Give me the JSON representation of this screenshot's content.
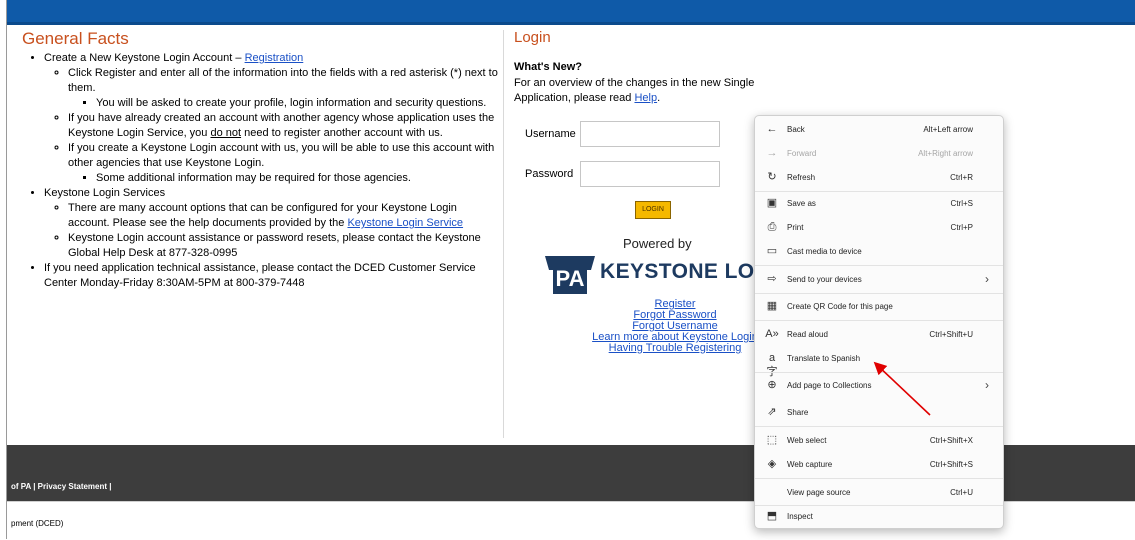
{
  "general_facts": {
    "title": "General Facts",
    "b1_text": "Create a New Keystone Login Account – ",
    "b1_link": "Registration",
    "b1_s1": "Click Register and enter all of the information into the fields with a red asterisk (*) next to them.",
    "b1_s1_s1": "You will be asked to create your profile, login information and security questions.",
    "b1_s2_pre": "If you have already created an account with another agency whose application uses the Keystone Login Service, you ",
    "b1_s2_u": "do not",
    "b1_s2_post": " need to register another account with us.",
    "b1_s3": "If you create a Keystone Login account with us, you will be able to use this account with other agencies that use Keystone Login.",
    "b1_s3_s1": "Some additional information may be required for those agencies.",
    "b2_text": "Keystone Login Services",
    "b2_s1_pre": "There are many account options that can be configured for your Keystone Login account. Please see the help documents provided by the ",
    "b2_s1_link": "Keystone Login Service",
    "b2_s2": "Keystone Login account assistance or password resets, please contact the Keystone Global Help Desk at 877-328-0995",
    "b3_text": "If you need application technical assistance, please contact the DCED Customer Service Center Monday-Friday 8:30AM-5PM at 800-379-7448"
  },
  "login": {
    "title": "Login",
    "whats_new_heading": "What's New?",
    "whats_new_text": "For an overview of the changes in the new Single Application, please read ",
    "whats_new_link": "Help",
    "whats_new_end": ".",
    "username_label": "Username",
    "password_label": "Password",
    "login_button": "LOGIN",
    "powered_by": "Powered by",
    "logo_pa": "PA",
    "logo_text": "KEYSTONE LOGIN",
    "links": [
      "Register",
      "Forgot Password",
      "Forgot Username",
      "Learn more about Keystone Login",
      "Having Trouble Registering"
    ]
  },
  "footer": {
    "dark_text": "of PA  |  Privacy Statement  |",
    "light_text": "pment (DCED)"
  },
  "context_menu": {
    "items": [
      {
        "icon": "back-arrow-icon",
        "label": "Back",
        "shortcut": "Alt+Left arrow",
        "enabled": true
      },
      {
        "icon": "forward-arrow-icon",
        "label": "Forward",
        "shortcut": "Alt+Right arrow",
        "enabled": false
      },
      {
        "icon": "refresh-icon",
        "label": "Refresh",
        "shortcut": "Ctrl+R",
        "enabled": true
      },
      {
        "icon": "save-icon",
        "label": "Save as",
        "shortcut": "Ctrl+S",
        "enabled": true
      },
      {
        "icon": "print-icon",
        "label": "Print",
        "shortcut": "Ctrl+P",
        "enabled": true
      },
      {
        "icon": "cast-icon",
        "label": "Cast media to device",
        "shortcut": "",
        "enabled": true
      },
      {
        "icon": "send-devices-icon",
        "label": "Send to your devices",
        "shortcut": "",
        "enabled": true,
        "submenu": true
      },
      {
        "icon": "qr-code-icon",
        "label": "Create QR Code for this page",
        "shortcut": "",
        "enabled": true
      },
      {
        "icon": "read-aloud-icon",
        "label": "Read aloud",
        "shortcut": "Ctrl+Shift+U",
        "enabled": true
      },
      {
        "icon": "translate-icon",
        "label": "Translate to Spanish",
        "shortcut": "",
        "enabled": true
      },
      {
        "icon": "collections-icon",
        "label": "Add page to Collections",
        "shortcut": "",
        "enabled": true,
        "submenu": true
      },
      {
        "icon": "share-icon",
        "label": "Share",
        "shortcut": "",
        "enabled": true
      },
      {
        "icon": "web-select-icon",
        "label": "Web select",
        "shortcut": "Ctrl+Shift+X",
        "enabled": true
      },
      {
        "icon": "web-capture-icon",
        "label": "Web capture",
        "shortcut": "Ctrl+Shift+S",
        "enabled": true
      },
      {
        "icon": "",
        "label": "View page source",
        "shortcut": "Ctrl+U",
        "enabled": true
      },
      {
        "icon": "inspect-icon",
        "label": "Inspect",
        "shortcut": "",
        "enabled": true
      }
    ]
  },
  "colors": {
    "header_blue": "#0f5aa8",
    "heading_orange": "#c8501e",
    "link_blue": "#1a50c6",
    "login_button_gold": "#f5b800",
    "footer_dark": "#3d3d3d",
    "annotation_arrow": "#e00000"
  }
}
